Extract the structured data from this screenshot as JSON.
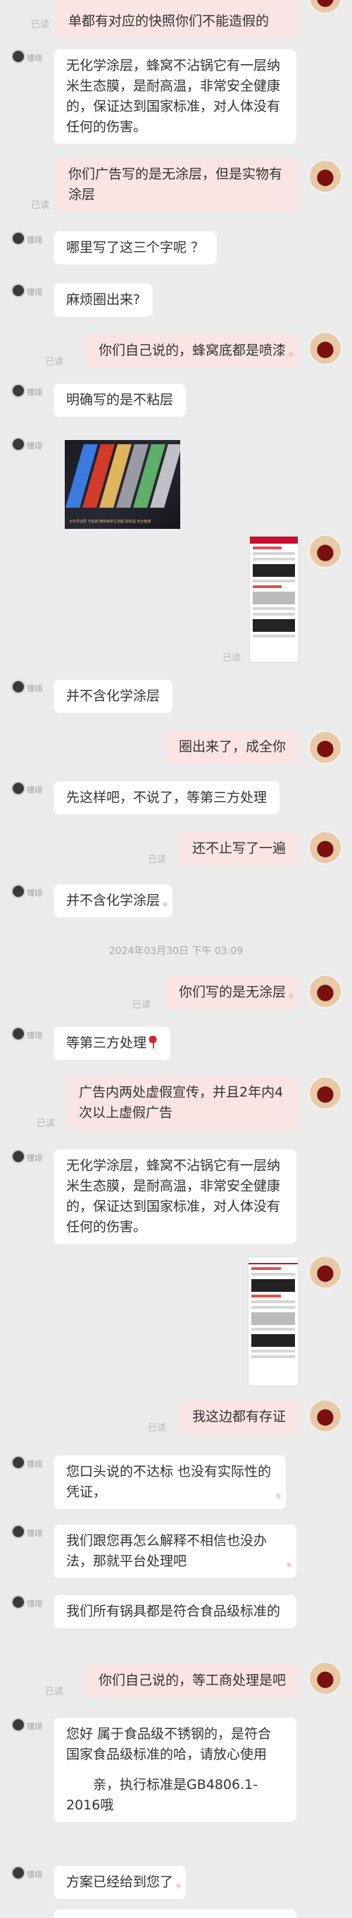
{
  "left_name": "锂翊",
  "read_label": "已读",
  "timestamp": "2024年03月30日 下午 03:09",
  "messages": {
    "m0": "单都有对应的快照你们不能造假的",
    "m1": "无化学涂层，蜂窝不沾锅它有一层纳米生态膜，是耐高温，非常安全健康的，保证达到国家标准，对人体没有任何的伤害。",
    "m2": "你们广告写的是无涂层，但是实物有涂层",
    "m3": "哪里写了这三个字呢 ？",
    "m4": "麻烦圈出来?",
    "m5": "你们自己说的，蜂窝底都是喷漆",
    "m6": "明确写的是不粘层",
    "m7": "并不含化学涂层",
    "m8": "圈出来了，成全你",
    "m9": "先这样吧，不说了，等第三方处理",
    "m10": "还不止写了一遍",
    "m11": "并不含化学涂层",
    "m12": "你们写的是无涂层",
    "m13": "等第三方处理",
    "m14": "广告内两处虚假宣传，并且2年内4次以上虚假广告",
    "m15": "无化学涂层，蜂窝不沾锅它有一层纳米生态膜，是耐高温，非常安全健康的，保证达到国家标准，对人体没有任何的伤害。",
    "m16": "我这边都有存证",
    "m17": "您口头说的不达标 也没有实际性的凭证，",
    "m18": "我们跟您再怎么解释不相信也没办法，那就平台处理吧",
    "m19": "我们所有锅具都是符合食品级标准的",
    "m20": "你们自己说的，等工商处理是吧",
    "m21a": "您好 属于食品级不锈钢的，是符合国家食品级标准的哈，请放心使用",
    "m21b": "亲，执行标准是GB4806.1-2016哦",
    "m22": "方案已经给到您了"
  },
  "image_caption": "无化学涂层 不粘锅 蜂窝纳米生态膜 耐高温 安全健康",
  "icons": [
    "avatar-merchant",
    "avatar-user",
    "heart-deco-icon",
    "rose-emoji"
  ],
  "colors": {
    "background": "#ebebeb",
    "bubble_left": "#ffffff",
    "bubble_right": "#fbe4e4",
    "read_text": "#b8b8b8"
  }
}
